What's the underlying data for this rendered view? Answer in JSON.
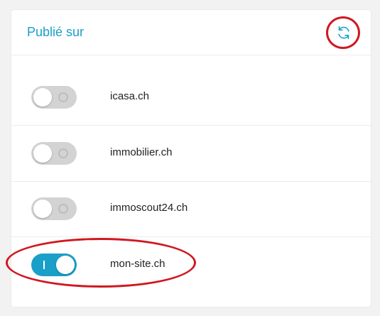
{
  "header": {
    "title": "Publié sur",
    "refresh_icon": "refresh-icon"
  },
  "platforms": [
    {
      "label": "icasa.ch",
      "enabled": false
    },
    {
      "label": "immobilier.ch",
      "enabled": false
    },
    {
      "label": "immoscout24.ch",
      "enabled": false
    },
    {
      "label": "mon-site.ch",
      "enabled": true
    }
  ],
  "colors": {
    "accent": "#1a9fc9",
    "toggle_off": "#d3d3d3",
    "annotation": "#d01820"
  }
}
